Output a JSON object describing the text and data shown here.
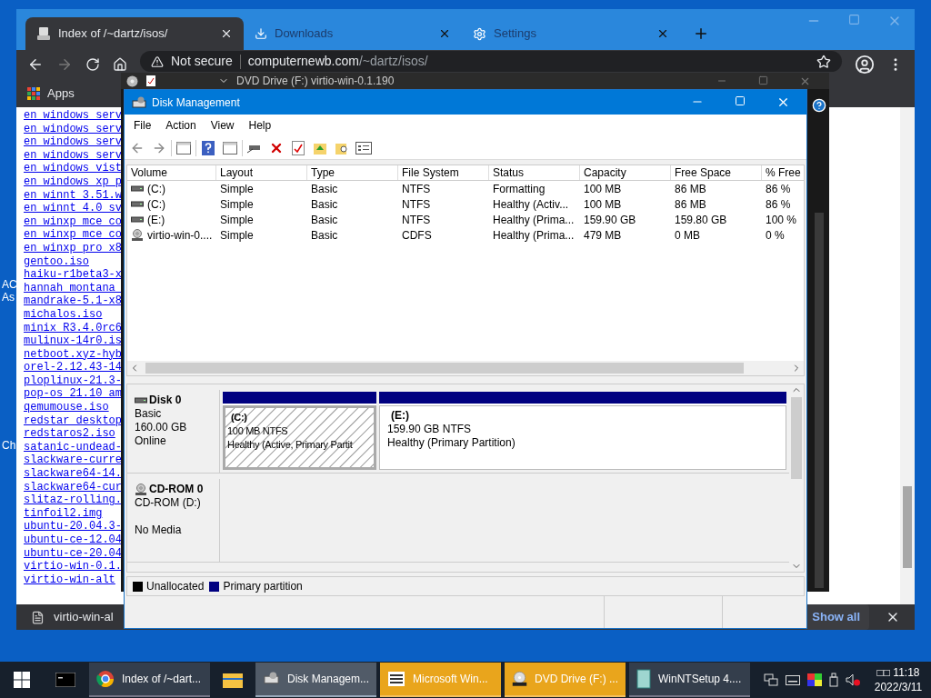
{
  "desktop": {
    "icon_labels": [
      "AC",
      "As",
      "Ch"
    ]
  },
  "browser": {
    "tabs": [
      {
        "title": "Index of /~dartz/isos/",
        "selected": true,
        "kind": "page"
      },
      {
        "title": "Downloads",
        "selected": false,
        "kind": "download"
      },
      {
        "title": "Settings",
        "selected": false,
        "kind": "settings"
      }
    ],
    "security": "Not secure",
    "url_host": "computernewb.com",
    "url_path": "/~dartz/isos/",
    "bookmarks": [
      "Apps"
    ],
    "links": [
      "en_windows_serv",
      "en_windows_serv",
      "en_windows_serv",
      "en_windows_serv",
      "en_windows_vist",
      "en_windows_xp_p",
      "en_winnt_3.51.w",
      "en_winnt_4.0_sv",
      "en_winxp_mce_co",
      "en_winxp_mce_co",
      "en_winxp_pro_x8",
      "gentoo.iso",
      "haiku-r1beta3-x",
      "hannah_montana_",
      "mandrake-5.1-x8",
      "michalos.iso",
      "minix_R3.4.0rc6",
      "mulinux-14r0.is",
      "netboot.xyz-hyb",
      "orel-2.12.43-14",
      "ploplinux-21.3-",
      "pop-os_21.10_am",
      "qemumouse.iso",
      "redstar_desktop",
      "redstaros2.iso",
      "satanic-undead-",
      "slackware-curre",
      "slackware64-14.",
      "slackware64-cur",
      "slitaz-rolling.",
      "tinfoil2.img",
      "ubuntu-20.04.3-",
      "ubuntu-ce-12.04",
      "ubuntu-ce-20.04",
      "virtio-win-0.1.",
      "virtio-win-alt"
    ],
    "download_file": "virtio-win-al",
    "show_all": "Show all"
  },
  "explorer_window": {
    "title": "DVD Drive (F:) virtio-win-0.1.190"
  },
  "disk_management": {
    "title": "Disk Management",
    "menu": [
      "File",
      "Action",
      "View",
      "Help"
    ],
    "columns": [
      "Volume",
      "Layout",
      "Type",
      "File System",
      "Status",
      "Capacity",
      "Free Space",
      "% Free"
    ],
    "rows": [
      {
        "kind": "disk",
        "cells": [
          "(C:)",
          "Simple",
          "Basic",
          "NTFS",
          "Formatting",
          "100 MB",
          "86 MB",
          "86 %"
        ]
      },
      {
        "kind": "disk",
        "cells": [
          "(C:)",
          "Simple",
          "Basic",
          "NTFS",
          "Healthy (Activ...",
          "100 MB",
          "86 MB",
          "86 %"
        ]
      },
      {
        "kind": "disk",
        "cells": [
          "(E:)",
          "Simple",
          "Basic",
          "NTFS",
          "Healthy (Prima...",
          "159.90 GB",
          "159.80 GB",
          "100 %"
        ]
      },
      {
        "kind": "cd",
        "cells": [
          "virtio-win-0....",
          "Simple",
          "Basic",
          "CDFS",
          "Healthy (Prima...",
          "479 MB",
          "0 MB",
          "0 %"
        ]
      }
    ],
    "disks": [
      {
        "kind": "disk",
        "name": "Disk 0",
        "lines": [
          "Basic",
          "160.00 GB",
          "Online"
        ],
        "partitions": [
          {
            "name": "(C:)",
            "size": "100 MB NTFS",
            "status": "Healthy (Active, Primary Partit",
            "selected": true,
            "color": "#000080"
          },
          {
            "name": "(E:)",
            "size": "159.90 GB NTFS",
            "status": "Healthy (Primary Partition)",
            "selected": false,
            "color": "#000080"
          }
        ]
      },
      {
        "kind": "cd",
        "name": "CD-ROM 0",
        "lines": [
          "CD-ROM (D:)"
        ],
        "media": "No Media"
      }
    ],
    "legend": [
      {
        "label": "Unallocated",
        "color": "#000000"
      },
      {
        "label": "Primary partition",
        "color": "#000080"
      }
    ]
  },
  "taskbar": {
    "items": [
      {
        "label": "Index of /~dart...",
        "kind": "chrome",
        "selected": false,
        "flashing": false
      },
      {
        "label": "Disk Managem...",
        "kind": "disk",
        "selected": true,
        "flashing": false
      },
      {
        "label": "Microsoft Win...",
        "kind": "list",
        "selected": false,
        "flashing": true
      },
      {
        "label": "DVD Drive (F:) ...",
        "kind": "dvd",
        "selected": false,
        "flashing": true
      },
      {
        "label": "WinNTSetup 4....",
        "kind": "setup",
        "selected": false,
        "flashing": false
      }
    ],
    "time": "□□ 11:18",
    "date": "2022/3/11"
  }
}
